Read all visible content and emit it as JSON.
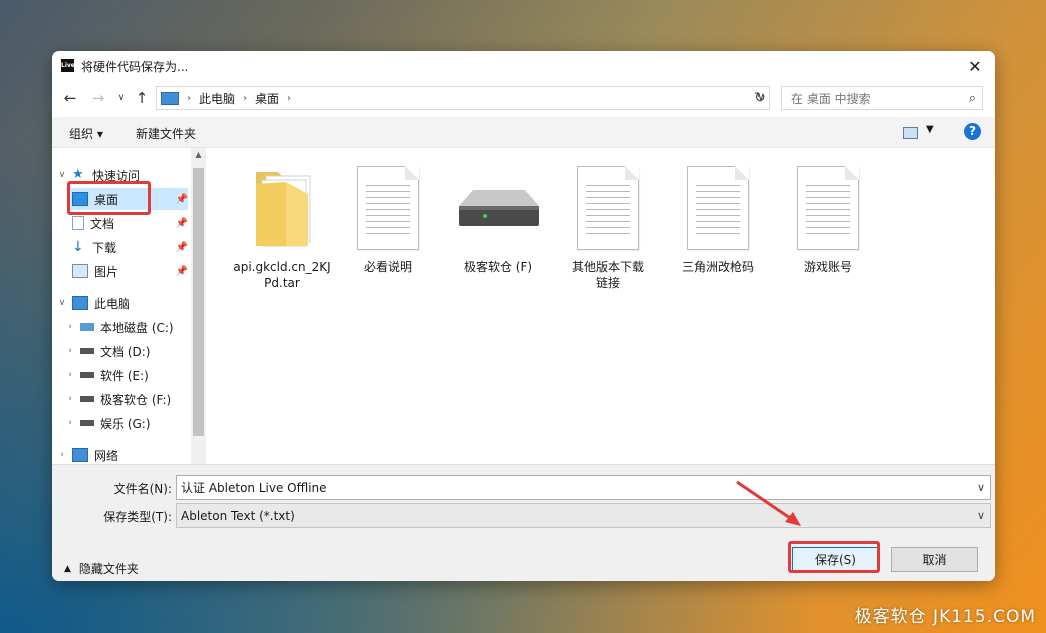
{
  "dialog": {
    "title": "将硬件代码保存为...",
    "app_logo_text": "Live"
  },
  "nav": {
    "breadcrumb": [
      "此电脑",
      "桌面"
    ],
    "search_placeholder": "在 桌面 中搜索"
  },
  "toolbar": {
    "organize": "组织 ▾",
    "new_folder": "新建文件夹",
    "help": "?"
  },
  "sidebar": {
    "quick_access": "快速访问",
    "quick_items": [
      "桌面",
      "文档",
      "下载",
      "图片"
    ],
    "this_pc": "此电脑",
    "drives": [
      "本地磁盘 (C:)",
      "文档 (D:)",
      "软件 (E:)",
      "极客软仓 (F:)",
      "娱乐 (G:)"
    ],
    "network": "网络"
  },
  "files": [
    {
      "name": "api.gkcld.cn_2KJPd.tar",
      "icon": "folder-icon"
    },
    {
      "name": "必看说明",
      "icon": "document-icon"
    },
    {
      "name": "极客软仓 (F)",
      "icon": "drive-icon"
    },
    {
      "name": "其他版本下载链接",
      "icon": "document-icon"
    },
    {
      "name": "三角洲改枪码",
      "icon": "document-icon"
    },
    {
      "name": "游戏账号",
      "icon": "document-icon"
    }
  ],
  "form": {
    "filename_label": "文件名(N):",
    "filename_value": "认证 Ableton Live Offline",
    "filetype_label": "保存类型(T):",
    "filetype_value": "Ableton Text (*.txt)",
    "hide_folders": "隐藏文件夹",
    "save_button": "保存(S)",
    "cancel_button": "取消"
  },
  "watermark": "极客软仓 JK115.COM",
  "colors": {
    "highlight": "#e03a3a",
    "accent": "#0078d7",
    "selection": "#cce8ff"
  }
}
